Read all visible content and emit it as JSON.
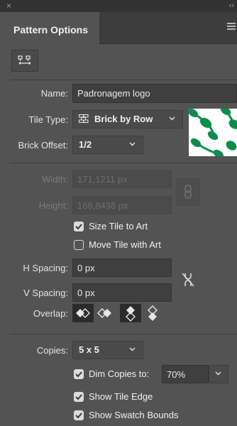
{
  "window": {
    "close_glyph": "×",
    "collapse_glyph": "‹‹"
  },
  "panel": {
    "title": "Pattern Options",
    "menu_icon": "panel-menu-icon"
  },
  "tool_icon": "pattern-tile-tool-icon",
  "name": {
    "label": "Name:",
    "value": "Padronagem logo"
  },
  "tile_type": {
    "label": "Tile Type:",
    "value": "Brick by Row",
    "icon": "brick-row-icon"
  },
  "brick_offset": {
    "label": "Brick Offset:",
    "value": "1/2"
  },
  "width": {
    "label": "Width:",
    "value": "171,1211 px"
  },
  "height": {
    "label": "Height:",
    "value": "166,8438 px"
  },
  "size_tile_to_art": {
    "label": "Size Tile to Art",
    "checked": true
  },
  "move_tile_with_art": {
    "label": "Move Tile with Art",
    "checked": false
  },
  "h_spacing": {
    "label": "H Spacing:",
    "value": "0 px"
  },
  "v_spacing": {
    "label": "V Spacing:",
    "value": "0 px"
  },
  "overlap": {
    "label": "Overlap:",
    "buttons": [
      "left-in-front-icon",
      "right-in-front-icon",
      "top-in-front-icon",
      "bottom-in-front-icon"
    ],
    "selected": [
      0,
      2
    ]
  },
  "copies": {
    "label": "Copies:",
    "value": "5 x 5"
  },
  "dim_copies": {
    "label": "Dim Copies to:",
    "checked": true,
    "value": "70%"
  },
  "show_tile_edge": {
    "label": "Show Tile Edge",
    "checked": true
  },
  "show_swatch_bounds": {
    "label": "Show Swatch Bounds",
    "checked": true
  },
  "colors": {
    "panel_bg": "#535353",
    "accent_green": "#0a8f4a"
  }
}
